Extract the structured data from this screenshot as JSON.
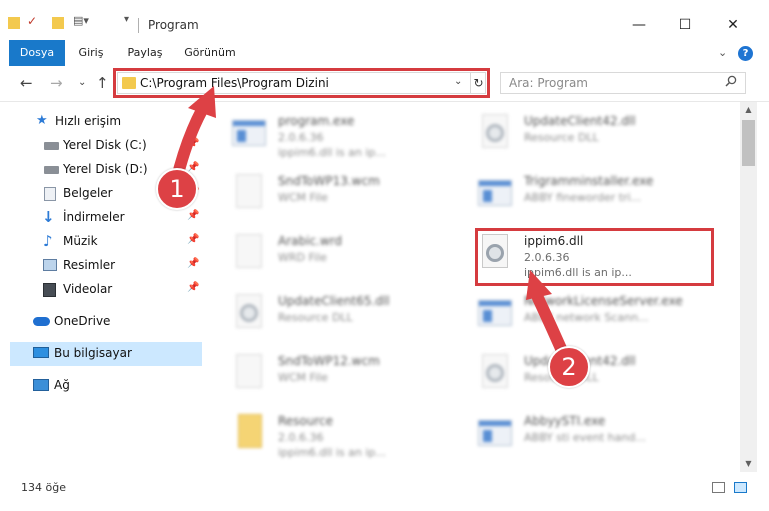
{
  "window": {
    "title": "Program",
    "minimize": "—",
    "maximize": "☐",
    "close": "✕"
  },
  "ribbon": {
    "tabs": [
      "Dosya",
      "Giriş",
      "Paylaş",
      "Görünüm"
    ],
    "collapse": "⌄",
    "help": "?"
  },
  "address": {
    "path": "C:\\Program Files\\Program Dizini",
    "dropdown": "⌄",
    "refresh": "↻"
  },
  "search": {
    "placeholder": "Ara: Program",
    "icon": "search-icon"
  },
  "nav": {
    "back": "←",
    "forward": "→",
    "recent": "⌄",
    "up": "↑"
  },
  "sidebar": {
    "items": [
      {
        "label": "Hızlı erişim",
        "icon": "star-icon",
        "pinned": false
      },
      {
        "label": "Yerel Disk (C:)",
        "icon": "drive-icon",
        "pinned": true
      },
      {
        "label": "Yerel Disk (D:)",
        "icon": "drive-icon",
        "pinned": true
      },
      {
        "label": "Belgeler",
        "icon": "documents-icon",
        "pinned": true
      },
      {
        "label": "İndirmeler",
        "icon": "download-icon",
        "pinned": true
      },
      {
        "label": "Müzik",
        "icon": "music-icon",
        "pinned": true
      },
      {
        "label": "Resimler",
        "icon": "pictures-icon",
        "pinned": true
      },
      {
        "label": "Videolar",
        "icon": "video-icon",
        "pinned": true
      },
      {
        "label": "OneDrive",
        "icon": "cloud-icon",
        "pinned": false
      },
      {
        "label": "Bu bilgisayar",
        "icon": "computer-icon",
        "pinned": false,
        "selected": true
      },
      {
        "label": "Ağ",
        "icon": "network-icon",
        "pinned": false
      }
    ]
  },
  "files": [
    {
      "name": "program.exe",
      "l2": "2.0.6.36",
      "l3": "ippim6.dll is an ip...",
      "kind": "exe"
    },
    {
      "name": "UpdateClient42.dll",
      "l2": "Resource DLL",
      "l3": "",
      "kind": "dll"
    },
    {
      "name": "SndToWP13.wcm",
      "l2": "WCM File",
      "l3": "",
      "kind": "doc"
    },
    {
      "name": "Trigramminstaller.exe",
      "l2": "ABBY fineworder tri...",
      "l3": "",
      "kind": "exe"
    },
    {
      "name": "Arabic.wrd",
      "l2": "WRD File",
      "l3": "",
      "kind": "doc"
    },
    {
      "name": "ippim6.dll",
      "l2": "2.0.6.36",
      "l3": "ippim6.dll is an ip...",
      "kind": "dll",
      "highlighted": true
    },
    {
      "name": "UpdateClient65.dll",
      "l2": "Resource DLL",
      "l3": "",
      "kind": "dll"
    },
    {
      "name": "NetworkLicenseServer.exe",
      "l2": "ABBY network Scann...",
      "l3": "",
      "kind": "exe"
    },
    {
      "name": "SndToWP12.wcm",
      "l2": "WCM File",
      "l3": "",
      "kind": "doc"
    },
    {
      "name": "UpdateClient42.dll",
      "l2": "Resource DLL",
      "l3": "",
      "kind": "dll"
    },
    {
      "name": "Resource",
      "l2": "2.0.6.36",
      "l3": "ippim6.dll is an ip...",
      "kind": "zip"
    },
    {
      "name": "AbbyySTI.exe",
      "l2": "ABBY sti event hand...",
      "l3": "",
      "kind": "exe"
    }
  ],
  "status": {
    "count": "134 öğe"
  },
  "annotations": {
    "badge1": "1",
    "badge2": "2",
    "color": "#dd4145"
  }
}
